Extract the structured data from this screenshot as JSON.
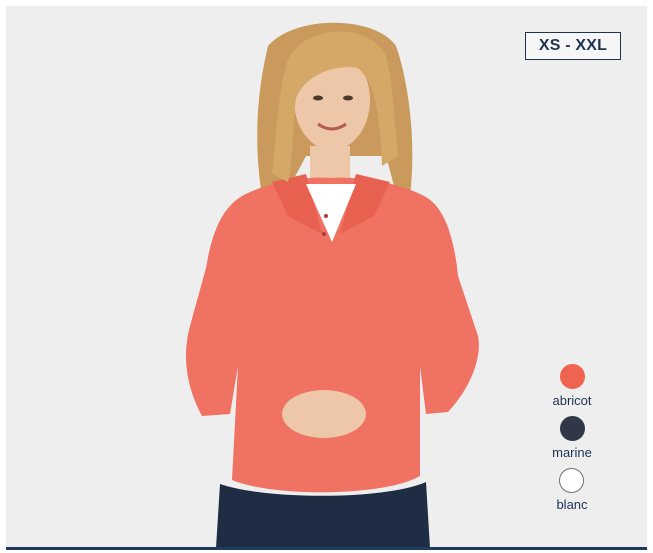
{
  "product": {
    "size_range": "XS - XXL",
    "image_subject": "woman-wearing-long-sleeve-polo"
  },
  "colors": {
    "options": [
      {
        "label": "abricot",
        "swatch": "#ef6450",
        "border": "#ef6450"
      },
      {
        "label": "marine",
        "swatch": "#303848",
        "border": "#303848"
      },
      {
        "label": "blanc",
        "swatch": "#ffffff",
        "border": "#6b7280"
      }
    ],
    "accent": "#1f3a5a",
    "shirt": "#ef7262",
    "jeans": "#1e2d44",
    "hair": "#c99a5c",
    "skin": "#eec6a8",
    "background": "#eeeeee"
  }
}
